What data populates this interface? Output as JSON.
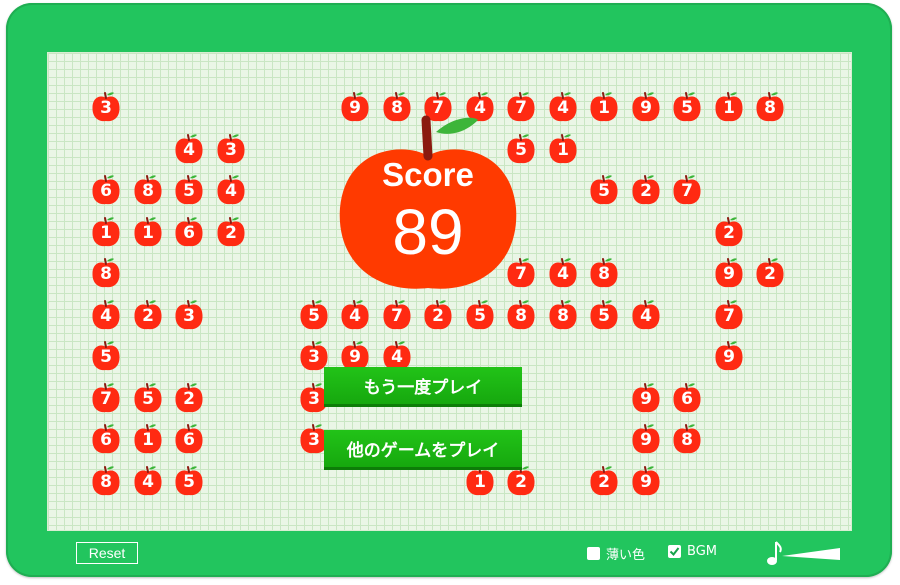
{
  "score": {
    "label": "Score",
    "value": "89"
  },
  "buttons": {
    "replay": "もう一度プレイ",
    "other_games": "他のゲームをプレイ"
  },
  "footer": {
    "reset": "Reset",
    "light_color_label": "薄い色",
    "light_color_checked": false,
    "bgm_label": "BGM",
    "bgm_checked": true,
    "music_icon": "music-note-volume-icon"
  },
  "colors": {
    "frame": "#22c55e",
    "apple": "#ff2a12",
    "button": "#1cb814",
    "leaf": "#3db53a",
    "stem": "#8b1a10"
  },
  "apples": [
    {
      "v": "3",
      "r": 0,
      "c": 0
    },
    {
      "v": "9",
      "r": 0,
      "c": 6
    },
    {
      "v": "8",
      "r": 0,
      "c": 7
    },
    {
      "v": "7",
      "r": 0,
      "c": 8
    },
    {
      "v": "4",
      "r": 0,
      "c": 9
    },
    {
      "v": "7",
      "r": 0,
      "c": 10
    },
    {
      "v": "4",
      "r": 0,
      "c": 11
    },
    {
      "v": "1",
      "r": 0,
      "c": 12
    },
    {
      "v": "9",
      "r": 0,
      "c": 13
    },
    {
      "v": "5",
      "r": 0,
      "c": 14
    },
    {
      "v": "1",
      "r": 0,
      "c": 15
    },
    {
      "v": "8",
      "r": 0,
      "c": 16
    },
    {
      "v": "4",
      "r": 1,
      "c": 2
    },
    {
      "v": "3",
      "r": 1,
      "c": 3
    },
    {
      "v": "5",
      "r": 1,
      "c": 10
    },
    {
      "v": "1",
      "r": 1,
      "c": 11
    },
    {
      "v": "6",
      "r": 2,
      "c": 0
    },
    {
      "v": "8",
      "r": 2,
      "c": 1
    },
    {
      "v": "5",
      "r": 2,
      "c": 2
    },
    {
      "v": "4",
      "r": 2,
      "c": 3
    },
    {
      "v": "5",
      "r": 2,
      "c": 12
    },
    {
      "v": "2",
      "r": 2,
      "c": 13
    },
    {
      "v": "7",
      "r": 2,
      "c": 14
    },
    {
      "v": "1",
      "r": 3,
      "c": 0
    },
    {
      "v": "1",
      "r": 3,
      "c": 1
    },
    {
      "v": "6",
      "r": 3,
      "c": 2
    },
    {
      "v": "2",
      "r": 3,
      "c": 3
    },
    {
      "v": "2",
      "r": 3,
      "c": 15
    },
    {
      "v": "8",
      "r": 4,
      "c": 0
    },
    {
      "v": "7",
      "r": 4,
      "c": 10
    },
    {
      "v": "4",
      "r": 4,
      "c": 11
    },
    {
      "v": "8",
      "r": 4,
      "c": 12
    },
    {
      "v": "9",
      "r": 4,
      "c": 15
    },
    {
      "v": "2",
      "r": 4,
      "c": 16
    },
    {
      "v": "4",
      "r": 5,
      "c": 0
    },
    {
      "v": "2",
      "r": 5,
      "c": 1
    },
    {
      "v": "3",
      "r": 5,
      "c": 2
    },
    {
      "v": "5",
      "r": 5,
      "c": 5
    },
    {
      "v": "4",
      "r": 5,
      "c": 6
    },
    {
      "v": "7",
      "r": 5,
      "c": 7
    },
    {
      "v": "2",
      "r": 5,
      "c": 8
    },
    {
      "v": "5",
      "r": 5,
      "c": 9
    },
    {
      "v": "8",
      "r": 5,
      "c": 10
    },
    {
      "v": "8",
      "r": 5,
      "c": 11
    },
    {
      "v": "5",
      "r": 5,
      "c": 12
    },
    {
      "v": "4",
      "r": 5,
      "c": 13
    },
    {
      "v": "7",
      "r": 5,
      "c": 15
    },
    {
      "v": "5",
      "r": 6,
      "c": 0
    },
    {
      "v": "3",
      "r": 6,
      "c": 5
    },
    {
      "v": "9",
      "r": 6,
      "c": 6
    },
    {
      "v": "4",
      "r": 6,
      "c": 7
    },
    {
      "v": "9",
      "r": 6,
      "c": 15
    },
    {
      "v": "7",
      "r": 7,
      "c": 0
    },
    {
      "v": "5",
      "r": 7,
      "c": 1
    },
    {
      "v": "2",
      "r": 7,
      "c": 2
    },
    {
      "v": "3",
      "r": 7,
      "c": 5
    },
    {
      "v": "9",
      "r": 7,
      "c": 13
    },
    {
      "v": "6",
      "r": 7,
      "c": 14
    },
    {
      "v": "6",
      "r": 8,
      "c": 0
    },
    {
      "v": "1",
      "r": 8,
      "c": 1
    },
    {
      "v": "6",
      "r": 8,
      "c": 2
    },
    {
      "v": "3",
      "r": 8,
      "c": 5
    },
    {
      "v": "9",
      "r": 8,
      "c": 13
    },
    {
      "v": "8",
      "r": 8,
      "c": 14
    },
    {
      "v": "8",
      "r": 9,
      "c": 0
    },
    {
      "v": "4",
      "r": 9,
      "c": 1
    },
    {
      "v": "5",
      "r": 9,
      "c": 2
    },
    {
      "v": "1",
      "r": 9,
      "c": 9
    },
    {
      "v": "2",
      "r": 9,
      "c": 10
    },
    {
      "v": "2",
      "r": 9,
      "c": 12
    },
    {
      "v": "9",
      "r": 9,
      "c": 13
    }
  ]
}
